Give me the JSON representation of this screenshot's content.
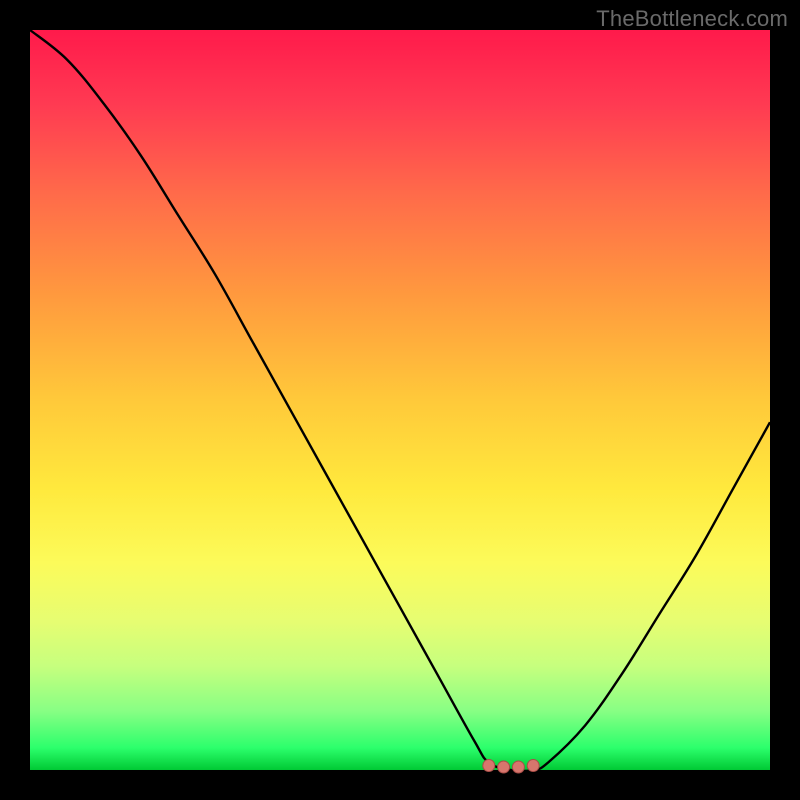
{
  "watermark": "TheBottleneck.com",
  "colors": {
    "frame": "#000000",
    "curve": "#000000",
    "marker_fill": "#d7766d",
    "marker_stroke": "#a94d47",
    "watermark": "#6a6a6a"
  },
  "chart_data": {
    "type": "line",
    "title": "",
    "xlabel": "",
    "ylabel": "",
    "xlim": [
      0,
      100
    ],
    "ylim": [
      0,
      100
    ],
    "grid": false,
    "legend": false,
    "series": [
      {
        "name": "curve",
        "x": [
          0,
          5,
          10,
          15,
          20,
          25,
          30,
          35,
          40,
          45,
          50,
          55,
          60,
          62,
          65,
          68,
          70,
          75,
          80,
          85,
          90,
          95,
          100
        ],
        "values": [
          100,
          96,
          90,
          83,
          75,
          67,
          58,
          49,
          40,
          31,
          22,
          13,
          4,
          1,
          0,
          0,
          1,
          6,
          13,
          21,
          29,
          38,
          47
        ]
      }
    ],
    "markers": {
      "x": [
        62,
        64,
        66,
        68
      ],
      "y": [
        0.6,
        0.4,
        0.4,
        0.6
      ]
    }
  }
}
